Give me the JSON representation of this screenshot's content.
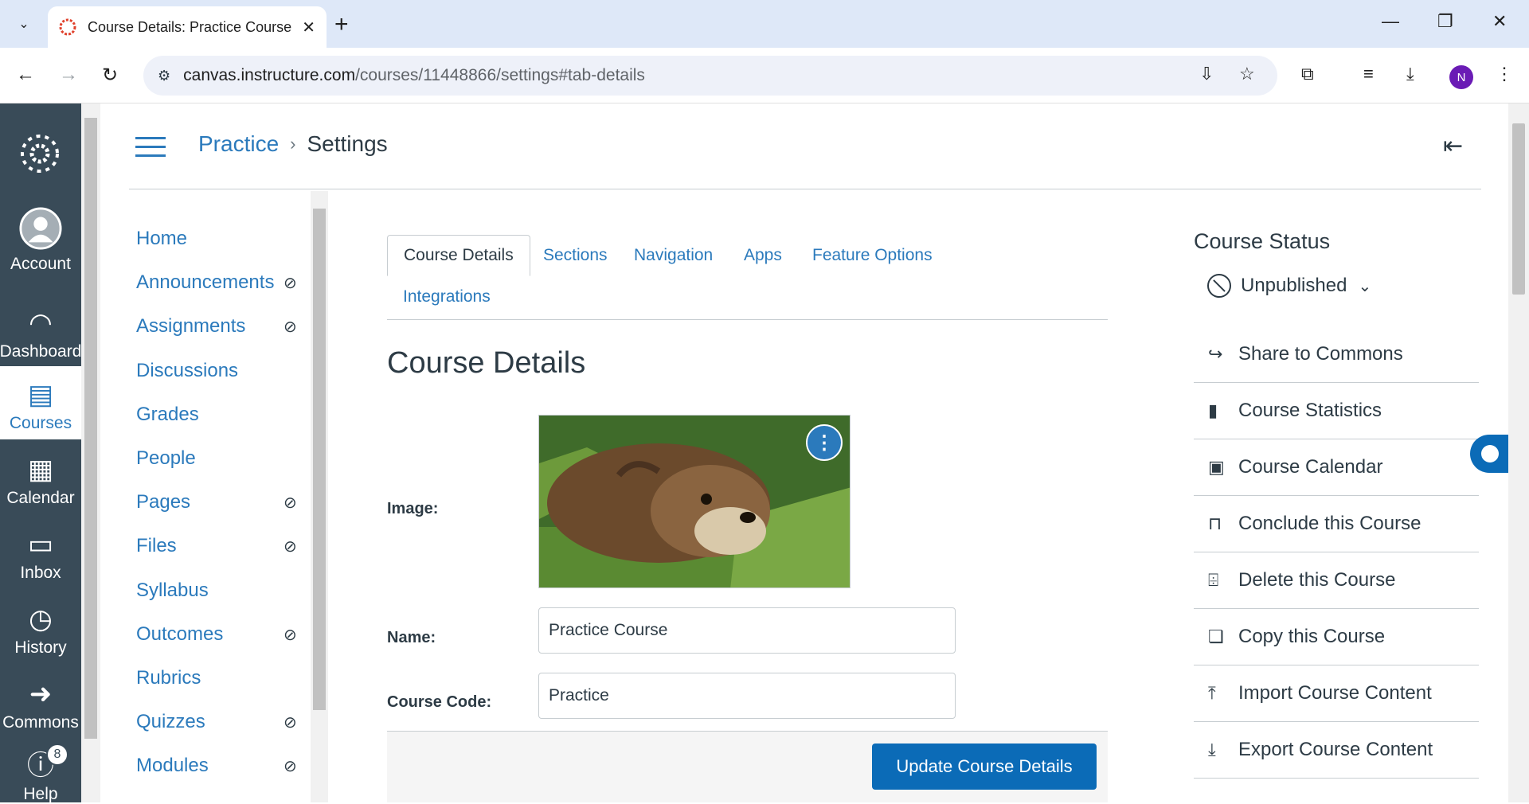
{
  "browser": {
    "tab_title": "Course Details: Practice Course",
    "url_host": "canvas.instructure.com",
    "url_path": "/courses/11448866/settings#tab-details",
    "profile_initial": "N"
  },
  "global_nav": [
    {
      "label": "Account",
      "icon": "account-icon"
    },
    {
      "label": "Dashboard",
      "icon": "dashboard-icon"
    },
    {
      "label": "Courses",
      "icon": "courses-icon",
      "active": true
    },
    {
      "label": "Calendar",
      "icon": "calendar-icon"
    },
    {
      "label": "Inbox",
      "icon": "inbox-icon"
    },
    {
      "label": "History",
      "icon": "history-icon"
    },
    {
      "label": "Commons",
      "icon": "commons-icon"
    },
    {
      "label": "Help",
      "icon": "help-icon",
      "badge": "8"
    }
  ],
  "breadcrumb": {
    "course": "Practice",
    "current": "Settings"
  },
  "course_nav": [
    {
      "label": "Home",
      "hidden": false
    },
    {
      "label": "Announcements",
      "hidden": true
    },
    {
      "label": "Assignments",
      "hidden": true
    },
    {
      "label": "Discussions",
      "hidden": false
    },
    {
      "label": "Grades",
      "hidden": false
    },
    {
      "label": "People",
      "hidden": false
    },
    {
      "label": "Pages",
      "hidden": true
    },
    {
      "label": "Files",
      "hidden": true
    },
    {
      "label": "Syllabus",
      "hidden": false
    },
    {
      "label": "Outcomes",
      "hidden": true
    },
    {
      "label": "Rubrics",
      "hidden": false
    },
    {
      "label": "Quizzes",
      "hidden": true
    },
    {
      "label": "Modules",
      "hidden": true
    }
  ],
  "tabs": [
    "Course Details",
    "Sections",
    "Navigation",
    "Apps",
    "Feature Options",
    "Integrations"
  ],
  "details": {
    "heading": "Course Details",
    "image_label": "Image:",
    "name_label": "Name:",
    "name_value": "Practice Course",
    "code_label": "Course Code:",
    "code_value": "Practice",
    "update_button": "Update Course Details"
  },
  "sidebar": {
    "title": "Course Status",
    "status": "Unpublished",
    "links": [
      {
        "label": "Share to Commons",
        "icon": "share-icon"
      },
      {
        "label": "Course Statistics",
        "icon": "bar-chart-icon"
      },
      {
        "label": "Course Calendar",
        "icon": "calendar-icon"
      },
      {
        "label": "Conclude this Course",
        "icon": "lock-icon"
      },
      {
        "label": "Delete this Course",
        "icon": "trash-icon"
      },
      {
        "label": "Copy this Course",
        "icon": "copy-icon"
      },
      {
        "label": "Import Course Content",
        "icon": "upload-icon"
      },
      {
        "label": "Export Course Content",
        "icon": "download-icon"
      }
    ]
  },
  "colors": {
    "accent": "#2b7abc",
    "nav_bg": "#394b58",
    "button": "#0b6bb7"
  }
}
